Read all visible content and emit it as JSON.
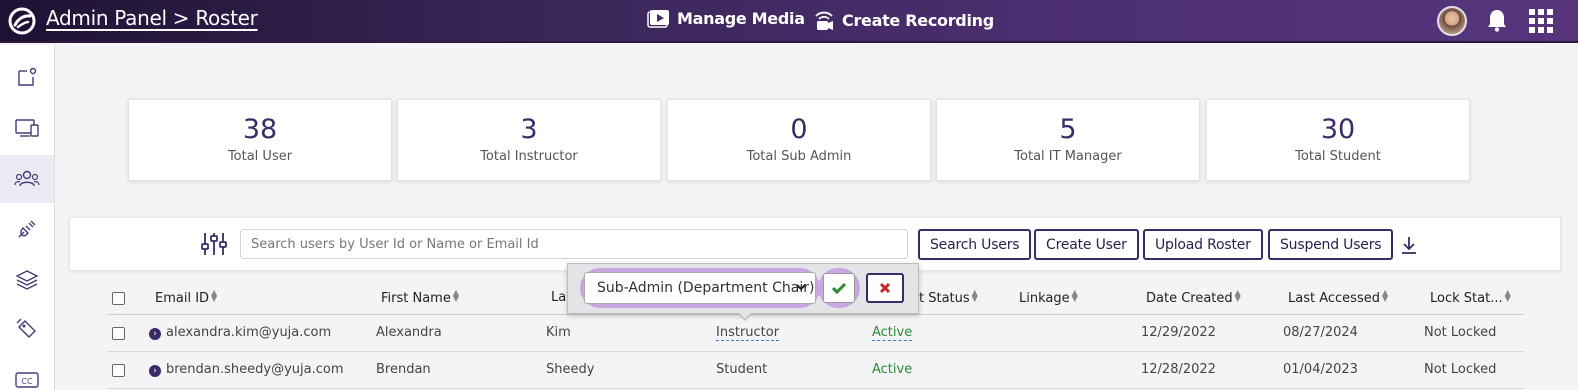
{
  "header": {
    "title": "Admin Panel > Roster",
    "nav": [
      {
        "label": "Manage Media",
        "icon": "play-media-icon"
      },
      {
        "label": "Create Recording",
        "icon": "recording-icon"
      }
    ]
  },
  "sidebar": {
    "items": [
      {
        "name": "new-content",
        "icon": "note-icon"
      },
      {
        "name": "devices",
        "icon": "devices-icon"
      },
      {
        "name": "users",
        "icon": "users-icon",
        "active": true
      },
      {
        "name": "integrations",
        "icon": "plug-icon"
      },
      {
        "name": "layers",
        "icon": "layers-icon"
      },
      {
        "name": "tags",
        "icon": "tag-icon"
      },
      {
        "name": "captions",
        "icon": "cc-icon",
        "label": "CC"
      }
    ]
  },
  "summary": [
    {
      "value": "38",
      "label": "Total User"
    },
    {
      "value": "3",
      "label": "Total Instructor"
    },
    {
      "value": "0",
      "label": "Total Sub Admin"
    },
    {
      "value": "5",
      "label": "Total IT Manager"
    },
    {
      "value": "30",
      "label": "Total Student"
    }
  ],
  "toolbar": {
    "search_placeholder": "Search users by User Id or Name or Email Id",
    "search_button": "Search Users",
    "create_button": "Create User",
    "upload_button": "Upload Roster",
    "suspend_button": "Suspend Users"
  },
  "table": {
    "headers": [
      "Email ID",
      "First Name",
      "Las",
      "t Status",
      "Linkage",
      "Date Created",
      "Last Accessed",
      "Lock Stat..."
    ],
    "rows": [
      {
        "email": "alexandra.kim@yuja.com",
        "first": "Alexandra",
        "last": "Kim",
        "role": "Instructor",
        "status": "Active",
        "linkage": "",
        "created": "12/29/2022",
        "accessed": "08/27/2024",
        "lock": "Not Locked"
      },
      {
        "email": "brendan.sheedy@yuja.com",
        "first": "Brendan",
        "last": "Sheedy",
        "role": "Student",
        "status": "Active",
        "linkage": "",
        "created": "12/28/2022",
        "accessed": "01/04/2023",
        "lock": "Not Locked"
      }
    ]
  },
  "role_editor": {
    "selected": "Sub-Admin (Department Chair)"
  },
  "colors": {
    "accent": "#3b2a66",
    "active_status": "#2a8a3a",
    "popup_highlight": "#c9a8e2"
  }
}
